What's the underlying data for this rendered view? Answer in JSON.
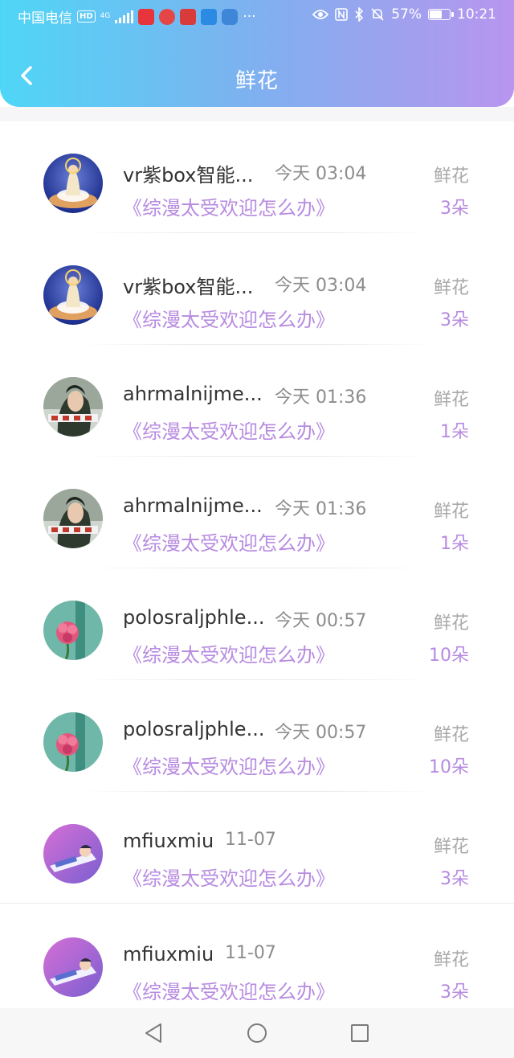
{
  "status_bar": {
    "carrier": "中国电信",
    "hd": "HD",
    "network": "4G",
    "battery_percent": "57%",
    "time": "10:21",
    "icons": [
      "eye-icon",
      "nfc-icon",
      "bluetooth-icon",
      "mute-icon",
      "battery-icon"
    ]
  },
  "header": {
    "title": "鲜花",
    "back_icon": "chevron-left-icon",
    "colors": {
      "gradient_start": "#4fd6f7",
      "gradient_end": "#b895ee"
    }
  },
  "records": [
    {
      "name": "vr紫box智能...",
      "time": "今天 03:04",
      "book": "《综漫太受欢迎怎么办》",
      "gift": "鲜花",
      "count": "3朵",
      "avatar": "guanyin"
    },
    {
      "name": "vr紫box智能...",
      "time": "今天 03:04",
      "book": "《综漫太受欢迎怎么办》",
      "gift": "鲜花",
      "count": "3朵",
      "avatar": "guanyin"
    },
    {
      "name": "ahrmalnijme...",
      "time": "今天 01:36",
      "book": "《综漫太受欢迎怎么办》",
      "gift": "鲜花",
      "count": "1朵",
      "avatar": "girl"
    },
    {
      "name": "ahrmalnijme...",
      "time": "今天 01:36",
      "book": "《综漫太受欢迎怎么办》",
      "gift": "鲜花",
      "count": "1朵",
      "avatar": "girl"
    },
    {
      "name": "polosraljphle...",
      "time": "今天 00:57",
      "book": "《综漫太受欢迎怎么办》",
      "gift": "鲜花",
      "count": "10朵",
      "avatar": "flower"
    },
    {
      "name": "polosraljphle...",
      "time": "今天 00:57",
      "book": "《综漫太受欢迎怎么办》",
      "gift": "鲜花",
      "count": "10朵",
      "avatar": "flower"
    },
    {
      "name": "mfiuxmiu",
      "time": "11-07",
      "book": "《综漫太受欢迎怎么办》",
      "gift": "鲜花",
      "count": "3朵",
      "avatar": "anime"
    },
    {
      "name": "mfiuxmiu",
      "time": "11-07",
      "book": "《综漫太受欢迎怎么办》",
      "gift": "鲜花",
      "count": "3朵",
      "avatar": "anime"
    }
  ],
  "nav": {
    "back": "triangle-back-icon",
    "home": "circle-home-icon",
    "recents": "square-recents-icon"
  }
}
